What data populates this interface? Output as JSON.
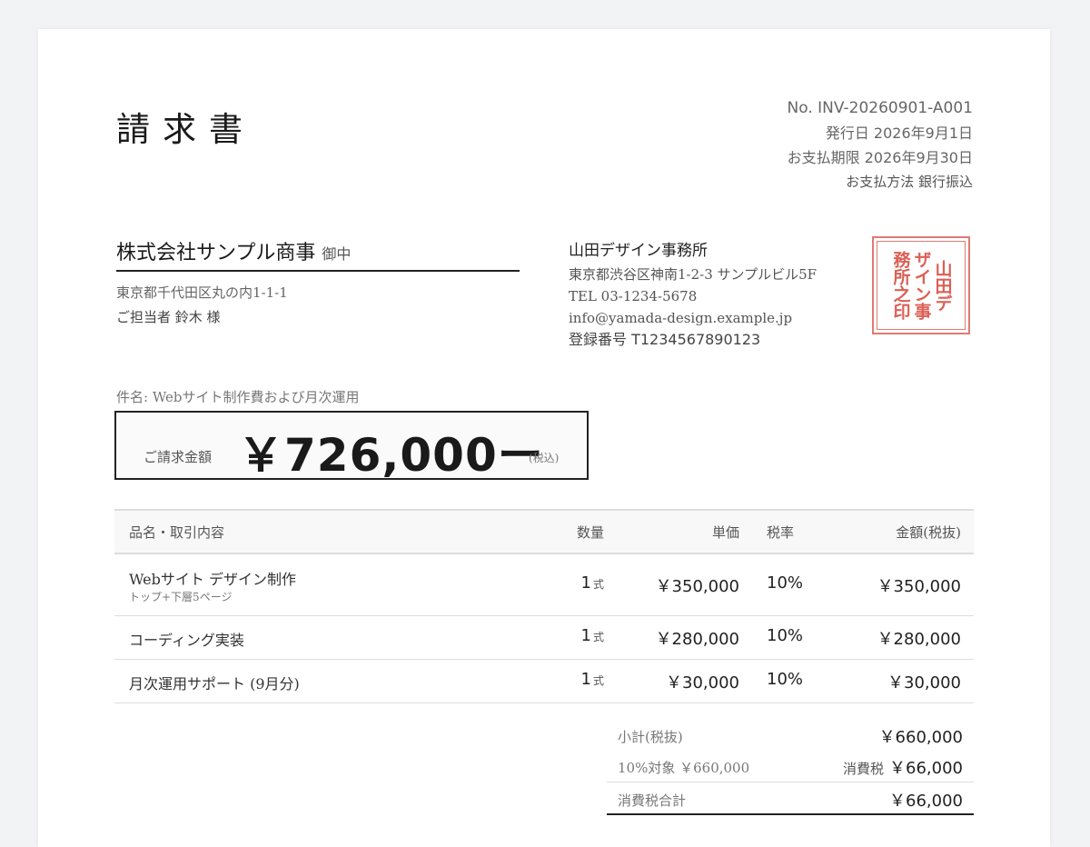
{
  "document": {
    "title": "請求書",
    "meta": {
      "number": "No. INV-20260901-A001",
      "issue_date": "発行日 2026年9月1日",
      "due_date": "お支払期限 2026年9月30日",
      "payment_method": "お支払方法 銀行振込"
    },
    "client": {
      "name": "株式会社サンプル商事",
      "suffix": "御中",
      "address": "東京都千代田区丸の内1-1-1",
      "contact": "ご担当者 鈴木 様"
    },
    "issuer": {
      "name": "山田デザイン事務所",
      "address": "東京都渋谷区神南1-2-3 サンプルビル5F",
      "tel": "TEL 03-1234-5678",
      "email": "info@yamada-design.example.jp",
      "registration": "登録番号 T1234567890123"
    },
    "stamp": {
      "columns": [
        "山田デ",
        "ザイン事",
        "務所之印"
      ],
      "color": "#dc5f55"
    },
    "subject": "件名: Webサイト制作費および月次運用",
    "total": {
      "label": "ご請求金額",
      "amount": "￥726,000ー",
      "tax_note": "(税込)"
    },
    "items_table": {
      "headers": {
        "name": "品名・取引内容",
        "qty": "数量",
        "unit_price": "単価",
        "tax_rate": "税率",
        "amount": "金額(税抜)"
      },
      "rows": [
        {
          "name": "Webサイト デザイン制作",
          "note": "トップ+下層5ページ",
          "qty": "1",
          "unit": "式",
          "unit_price": "￥350,000",
          "tax_rate": "10%",
          "amount": "￥350,000"
        },
        {
          "name": "コーディング実装",
          "note": "",
          "qty": "1",
          "unit": "式",
          "unit_price": "￥280,000",
          "tax_rate": "10%",
          "amount": "￥280,000"
        },
        {
          "name": "月次運用サポート (9月分)",
          "note": "",
          "qty": "1",
          "unit": "式",
          "unit_price": "￥30,000",
          "tax_rate": "10%",
          "amount": "￥30,000"
        }
      ]
    },
    "totals": {
      "subtotal_label": "小計(税抜)",
      "subtotal_value": "￥660,000",
      "taxable_label": "10%対象 ￥660,000",
      "tax_label": "消費税",
      "tax_value": "￥66,000",
      "tax_total_label": "消費税合計",
      "tax_total_value": "￥66,000"
    }
  }
}
